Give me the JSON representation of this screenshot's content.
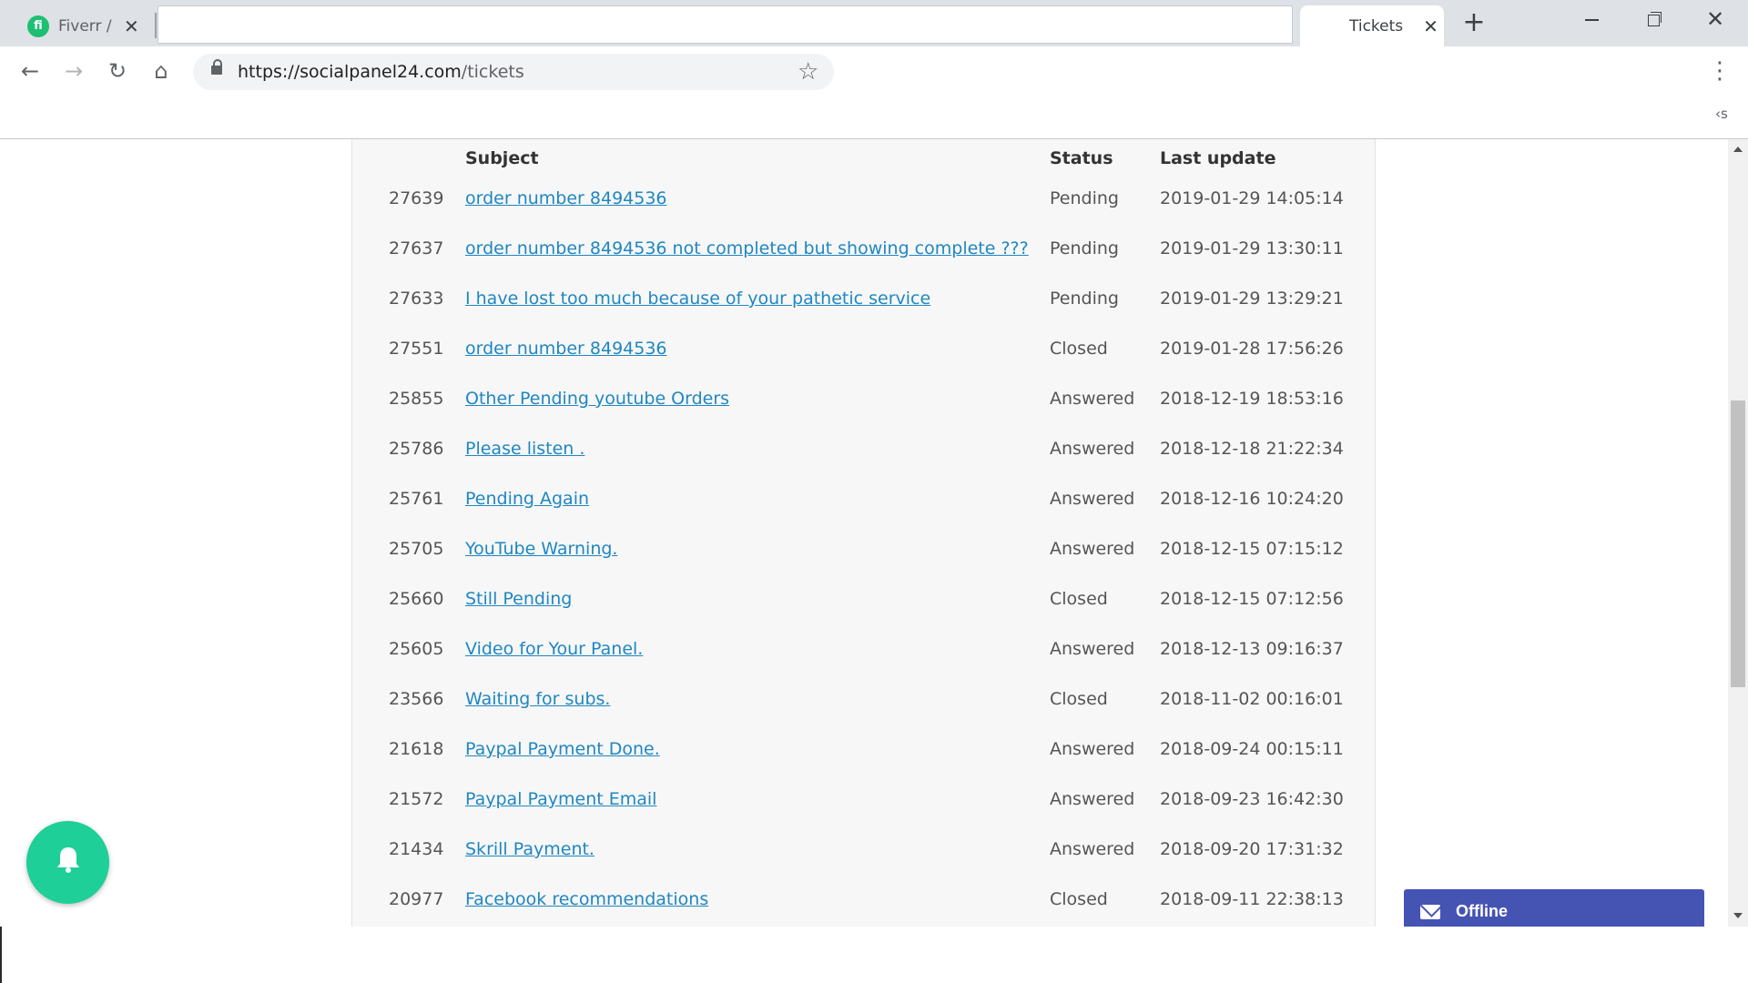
{
  "browser": {
    "tabs": [
      {
        "title": "Fiverr /",
        "favicon": "fi"
      },
      {
        "title": "Tickets"
      }
    ],
    "url_host": "https://socialpanel24.com",
    "url_path": "/tickets",
    "bookmarks_overflow": "‹s"
  },
  "table": {
    "headers": {
      "subject": "Subject",
      "status": "Status",
      "last_update": "Last update"
    },
    "rows": [
      {
        "id": "27639",
        "subject": "order number 8494536",
        "status": "Pending",
        "last_update": "2019-01-29 14:05:14"
      },
      {
        "id": "27637",
        "subject": "order number 8494536 not completed but showing complete ???",
        "status": "Pending",
        "last_update": "2019-01-29 13:30:11"
      },
      {
        "id": "27633",
        "subject": "I have lost too much because of your pathetic service",
        "status": "Pending",
        "last_update": "2019-01-29 13:29:21"
      },
      {
        "id": "27551",
        "subject": "order number 8494536",
        "status": "Closed",
        "last_update": "2019-01-28 17:56:26"
      },
      {
        "id": "25855",
        "subject": "Other Pending youtube Orders",
        "status": "Answered",
        "last_update": "2018-12-19 18:53:16"
      },
      {
        "id": "25786",
        "subject": "Please listen .",
        "status": "Answered",
        "last_update": "2018-12-18 21:22:34"
      },
      {
        "id": "25761",
        "subject": "Pending Again",
        "status": "Answered",
        "last_update": "2018-12-16 10:24:20"
      },
      {
        "id": "25705",
        "subject": "YouTube Warning.",
        "status": "Answered",
        "last_update": "2018-12-15 07:15:12"
      },
      {
        "id": "25660",
        "subject": "Still Pending",
        "status": "Closed",
        "last_update": "2018-12-15 07:12:56"
      },
      {
        "id": "25605",
        "subject": "Video for Your Panel.",
        "status": "Answered",
        "last_update": "2018-12-13 09:16:37"
      },
      {
        "id": "23566",
        "subject": "Waiting for subs.",
        "status": "Closed",
        "last_update": "2018-11-02 00:16:01"
      },
      {
        "id": "21618",
        "subject": "Paypal Payment Done.",
        "status": "Answered",
        "last_update": "2018-09-24 00:15:11"
      },
      {
        "id": "21572",
        "subject": "Paypal Payment Email",
        "status": "Answered",
        "last_update": "2018-09-23 16:42:30"
      },
      {
        "id": "21434",
        "subject": "Skrill Payment.",
        "status": "Answered",
        "last_update": "2018-09-20 17:31:32"
      },
      {
        "id": "20977",
        "subject": "Facebook recommendations",
        "status": "Closed",
        "last_update": "2018-09-11 22:38:13"
      }
    ]
  },
  "chat_widget": {
    "label": "Offline",
    "icon": "mail-icon",
    "color": "#4553b3"
  },
  "notification_button": {
    "icon": "bell-icon",
    "color": "#1ecf98"
  },
  "colors": {
    "link": "#1f87c2",
    "fiverr": "#1dbf73"
  }
}
